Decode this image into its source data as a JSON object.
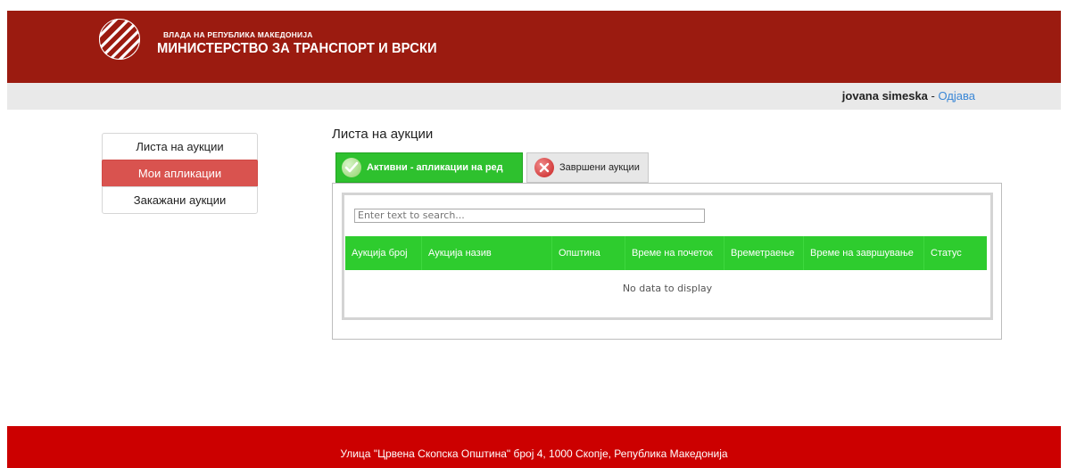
{
  "header": {
    "org_sub": "ВЛАДА НА РЕПУБЛИКА МАКЕДОНИЈА",
    "org_main": "МИНИСТЕРСТВО ЗА ТРАНСПОРТ И ВРСКИ",
    "logo_icon": "ministry-logo",
    "background_color": "#9b1b10"
  },
  "userbar": {
    "username": "jovana simeska",
    "separator": " - ",
    "logout_label": "Одјава"
  },
  "sidebar": {
    "items": [
      {
        "label": "Листа на аукции",
        "active": false
      },
      {
        "label": "Мои апликации",
        "active": true
      },
      {
        "label": "Закажани аукции",
        "active": false
      }
    ],
    "active_color": "#d9534f"
  },
  "main": {
    "title": "Листа на аукции",
    "tabs": [
      {
        "label": "Активни - апликации на ред",
        "icon": "check-icon",
        "active": true
      },
      {
        "label": "Завршени аукции",
        "icon": "close-icon",
        "active": false
      }
    ],
    "search": {
      "placeholder": "Enter text to search..."
    },
    "columns": [
      "Аукција број",
      "Аукција назив",
      "Општина",
      "Време на почеток",
      "Времетраење",
      "Време на завршување",
      "Статус"
    ],
    "empty_message": "No data to display",
    "accent_color": "#2ecc2e"
  },
  "footer": {
    "address": "Улица \"Црвена Скопска Општина\" број 4, 1000 Скопје, Република Македонија",
    "background_color": "#cc0000"
  }
}
